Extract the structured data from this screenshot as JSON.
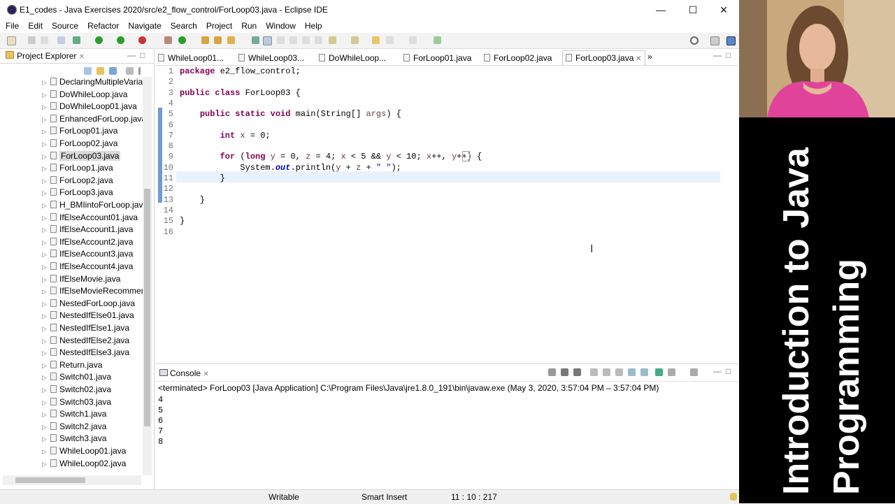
{
  "window": {
    "title": "E1_codes - Java Exercises 2020/src/e2_flow_control/ForLoop03.java - Eclipse IDE",
    "controls": [
      "minimize-icon",
      "maximize-icon",
      "close-icon"
    ]
  },
  "menu": [
    "File",
    "Edit",
    "Source",
    "Refactor",
    "Navigate",
    "Search",
    "Project",
    "Run",
    "Window",
    "Help"
  ],
  "explorer": {
    "title": "Project Explorer",
    "items": [
      {
        "label": "DeclaringMultipleVaria",
        "selected": false
      },
      {
        "label": "DoWhileLoop.java",
        "selected": false
      },
      {
        "label": "DoWhileLoop01.java",
        "selected": false
      },
      {
        "label": "EnhancedForLoop.java",
        "selected": false
      },
      {
        "label": "ForLoop01.java",
        "selected": false
      },
      {
        "label": "ForLoop02.java",
        "selected": false
      },
      {
        "label": "ForLoop03.java",
        "selected": true
      },
      {
        "label": "ForLoop1.java",
        "selected": false
      },
      {
        "label": "ForLoop2.java",
        "selected": false
      },
      {
        "label": "ForLoop3.java",
        "selected": false
      },
      {
        "label": "H_BMIintoForLoop.java",
        "selected": false
      },
      {
        "label": "IfElseAccount01.java",
        "selected": false
      },
      {
        "label": "IfElseAccount1.java",
        "selected": false
      },
      {
        "label": "IfElseAccount2.java",
        "selected": false
      },
      {
        "label": "IfElseAccount3.java",
        "selected": false
      },
      {
        "label": "IfElseAccount4.java",
        "selected": false
      },
      {
        "label": "IfElseMovie.java",
        "selected": false
      },
      {
        "label": "IfElseMovieRecommen",
        "selected": false
      },
      {
        "label": "NestedForLoop.java",
        "selected": false
      },
      {
        "label": "NestedIfElse01.java",
        "selected": false
      },
      {
        "label": "NestedIfElse1.java",
        "selected": false
      },
      {
        "label": "NestedIfElse2.java",
        "selected": false
      },
      {
        "label": "NestedIfElse3.java",
        "selected": false
      },
      {
        "label": "Return.java",
        "selected": false
      },
      {
        "label": "Switch01.java",
        "selected": false
      },
      {
        "label": "Switch02.java",
        "selected": false
      },
      {
        "label": "Switch03.java",
        "selected": false
      },
      {
        "label": "Switch1.java",
        "selected": false
      },
      {
        "label": "Switch2.java",
        "selected": false
      },
      {
        "label": "Switch3.java",
        "selected": false
      },
      {
        "label": "WhileLoop01.java",
        "selected": false
      },
      {
        "label": "WhileLoop02.java",
        "selected": false
      }
    ]
  },
  "editor": {
    "tabs": [
      {
        "label": "WhileLoop01...",
        "active": false
      },
      {
        "label": "WhileLoop03...",
        "active": false
      },
      {
        "label": "DoWhileLoop...",
        "active": false
      },
      {
        "label": "ForLoop01.java",
        "active": false
      },
      {
        "label": "ForLoop02.java",
        "active": false
      },
      {
        "label": "ForLoop03.java",
        "active": true
      }
    ],
    "overflow": "»",
    "lines": [
      {
        "n": "1",
        "tokens": [
          [
            "kw",
            "package"
          ],
          [
            "t",
            " e2_flow_control;"
          ]
        ]
      },
      {
        "n": "2",
        "tokens": []
      },
      {
        "n": "3",
        "tokens": [
          [
            "kw",
            "public"
          ],
          [
            "t",
            " "
          ],
          [
            "kw",
            "class"
          ],
          [
            "t",
            " ForLoop03 {"
          ]
        ]
      },
      {
        "n": "4",
        "tokens": []
      },
      {
        "n": "5",
        "tokens": [
          [
            "t",
            "    "
          ],
          [
            "kw",
            "public"
          ],
          [
            "t",
            " "
          ],
          [
            "kw",
            "static"
          ],
          [
            "t",
            " "
          ],
          [
            "kw",
            "void"
          ],
          [
            "t",
            " main(String[] "
          ],
          [
            "param",
            "args"
          ],
          [
            "t",
            ") {"
          ]
        ]
      },
      {
        "n": "6",
        "tokens": []
      },
      {
        "n": "7",
        "tokens": [
          [
            "t",
            "        "
          ],
          [
            "kw",
            "int"
          ],
          [
            "t",
            " "
          ],
          [
            "param",
            "x"
          ],
          [
            "t",
            " = 0;"
          ]
        ]
      },
      {
        "n": "8",
        "tokens": []
      },
      {
        "n": "9",
        "tokens": [
          [
            "t",
            "        "
          ],
          [
            "kw",
            "for"
          ],
          [
            "t",
            " ("
          ],
          [
            "kw",
            "long"
          ],
          [
            "t",
            " "
          ],
          [
            "param",
            "y"
          ],
          [
            "t",
            " = 0, "
          ],
          [
            "param",
            "z"
          ],
          [
            "t",
            " = 4; "
          ],
          [
            "param",
            "x"
          ],
          [
            "t",
            " < 5 && "
          ],
          [
            "param",
            "y"
          ],
          [
            "t",
            " < 10; "
          ],
          [
            "param",
            "x"
          ],
          [
            "t",
            "++, "
          ],
          [
            "param",
            "y"
          ],
          [
            "t",
            "++) {"
          ]
        ]
      },
      {
        "n": "10",
        "tokens": [
          [
            "t",
            "            System."
          ],
          [
            "fld",
            "out"
          ],
          [
            "t",
            ".println("
          ],
          [
            "param",
            "y"
          ],
          [
            "t",
            " + "
          ],
          [
            "param",
            "z"
          ],
          [
            "t",
            " + "
          ],
          [
            "str",
            "\" \""
          ],
          [
            "t",
            ");"
          ]
        ]
      },
      {
        "n": "11",
        "tokens": [
          [
            "t",
            "        }"
          ]
        ]
      },
      {
        "n": "12",
        "tokens": []
      },
      {
        "n": "13",
        "tokens": [
          [
            "t",
            "    }"
          ]
        ]
      },
      {
        "n": "14",
        "tokens": []
      },
      {
        "n": "15",
        "tokens": [
          [
            "t",
            "}"
          ]
        ]
      },
      {
        "n": "16",
        "tokens": []
      }
    ]
  },
  "console": {
    "title": "Console",
    "terminated": "<terminated> ForLoop03 [Java Application] C:\\Program Files\\Java\\jre1.8.0_191\\bin\\javaw.exe  (May 3, 2020, 3:57:04 PM – 3:57:04 PM)",
    "output": [
      "4",
      "5",
      "6",
      "7",
      "8"
    ]
  },
  "status": {
    "mode": "Writable",
    "insert": "Smart Insert",
    "position": "11 : 10 : 217"
  },
  "video": {
    "title_line1": "Introduction to Java",
    "title_line2": "Programming"
  }
}
